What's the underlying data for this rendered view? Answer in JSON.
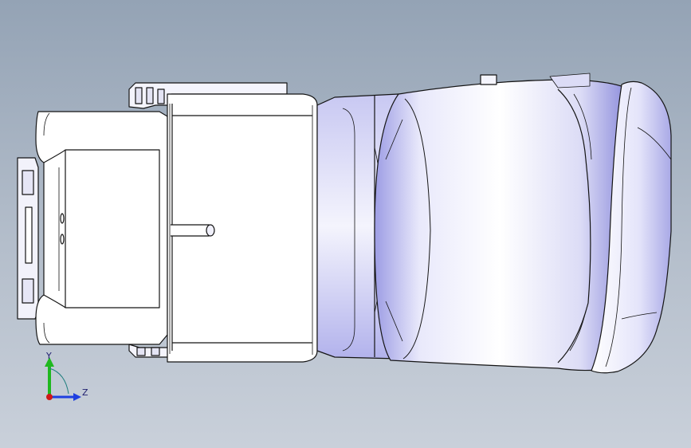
{
  "viewport": {
    "background_top": "#94a3b5",
    "background_bottom": "#c9d0da",
    "model_fill": "#ffffff",
    "model_shade": "#b9b9ec",
    "edge_color": "#141414"
  },
  "triad": {
    "y_label": "Y",
    "z_label": "Z",
    "y_color": "#1fb81f",
    "z_color": "#1f3fe0",
    "x_color": "#d01818"
  }
}
